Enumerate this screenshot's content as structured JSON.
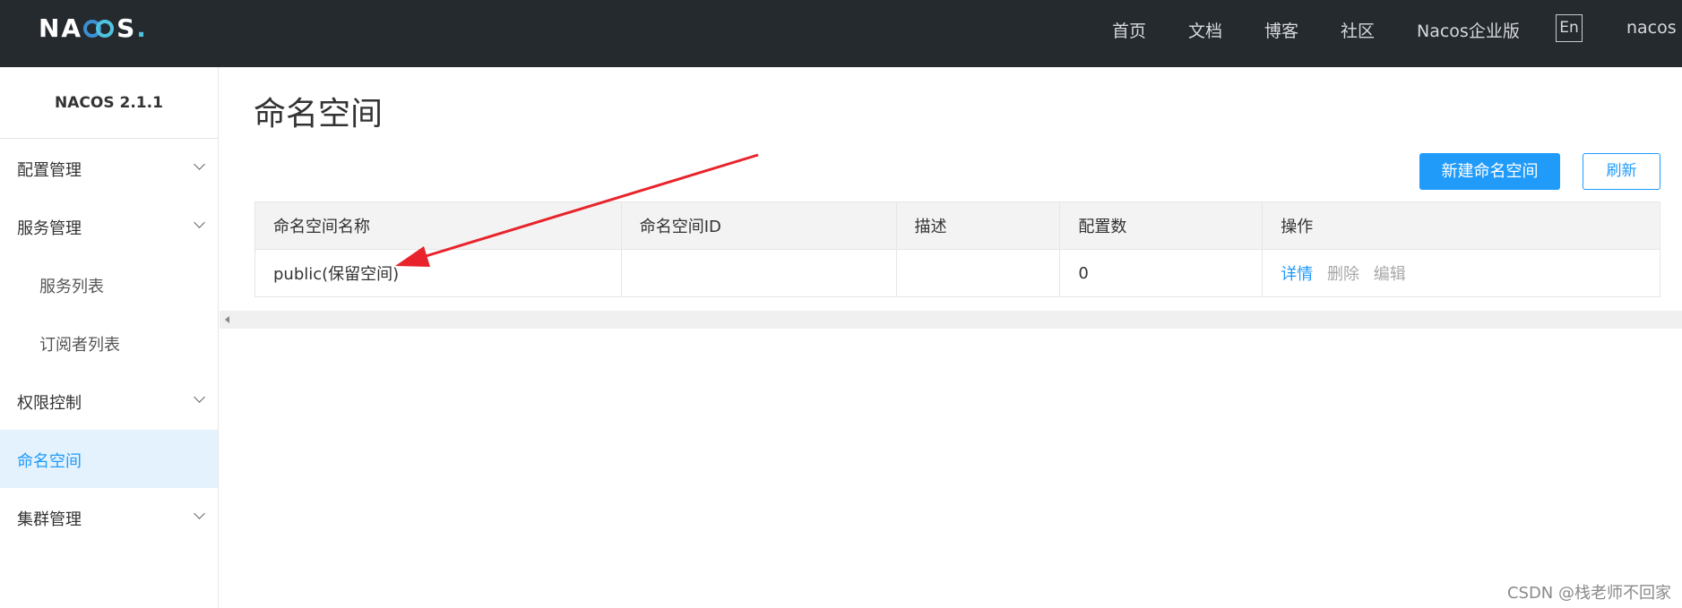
{
  "header": {
    "logo_text": "NACOS",
    "nav": [
      "首页",
      "文档",
      "博客",
      "社区",
      "Nacos企业版"
    ],
    "lang_button": "En",
    "user": "nacos"
  },
  "sidebar": {
    "version": "NACOS 2.1.1",
    "items": [
      {
        "label": "配置管理"
      },
      {
        "label": "服务管理"
      },
      {
        "label": "服务列表"
      },
      {
        "label": "订阅者列表"
      },
      {
        "label": "权限控制"
      },
      {
        "label": "命名空间"
      },
      {
        "label": "集群管理"
      }
    ]
  },
  "main": {
    "title": "命名空间",
    "new_button": "新建命名空间",
    "refresh_button": "刷新",
    "table": {
      "headers": [
        "命名空间名称",
        "命名空间ID",
        "描述",
        "配置数",
        "操作"
      ],
      "rows": [
        {
          "name": "public(保留空间)",
          "id": "",
          "description": "",
          "config_count": "0",
          "actions": {
            "detail": "详情",
            "delete": "删除",
            "edit": "编辑"
          }
        }
      ]
    }
  },
  "watermark": "CSDN @栈老师不回家",
  "colors": {
    "topbar": "#252a2f",
    "accent": "#209bfa",
    "active_bg": "#e3f2fd",
    "annotation_arrow": "#e8232b"
  }
}
